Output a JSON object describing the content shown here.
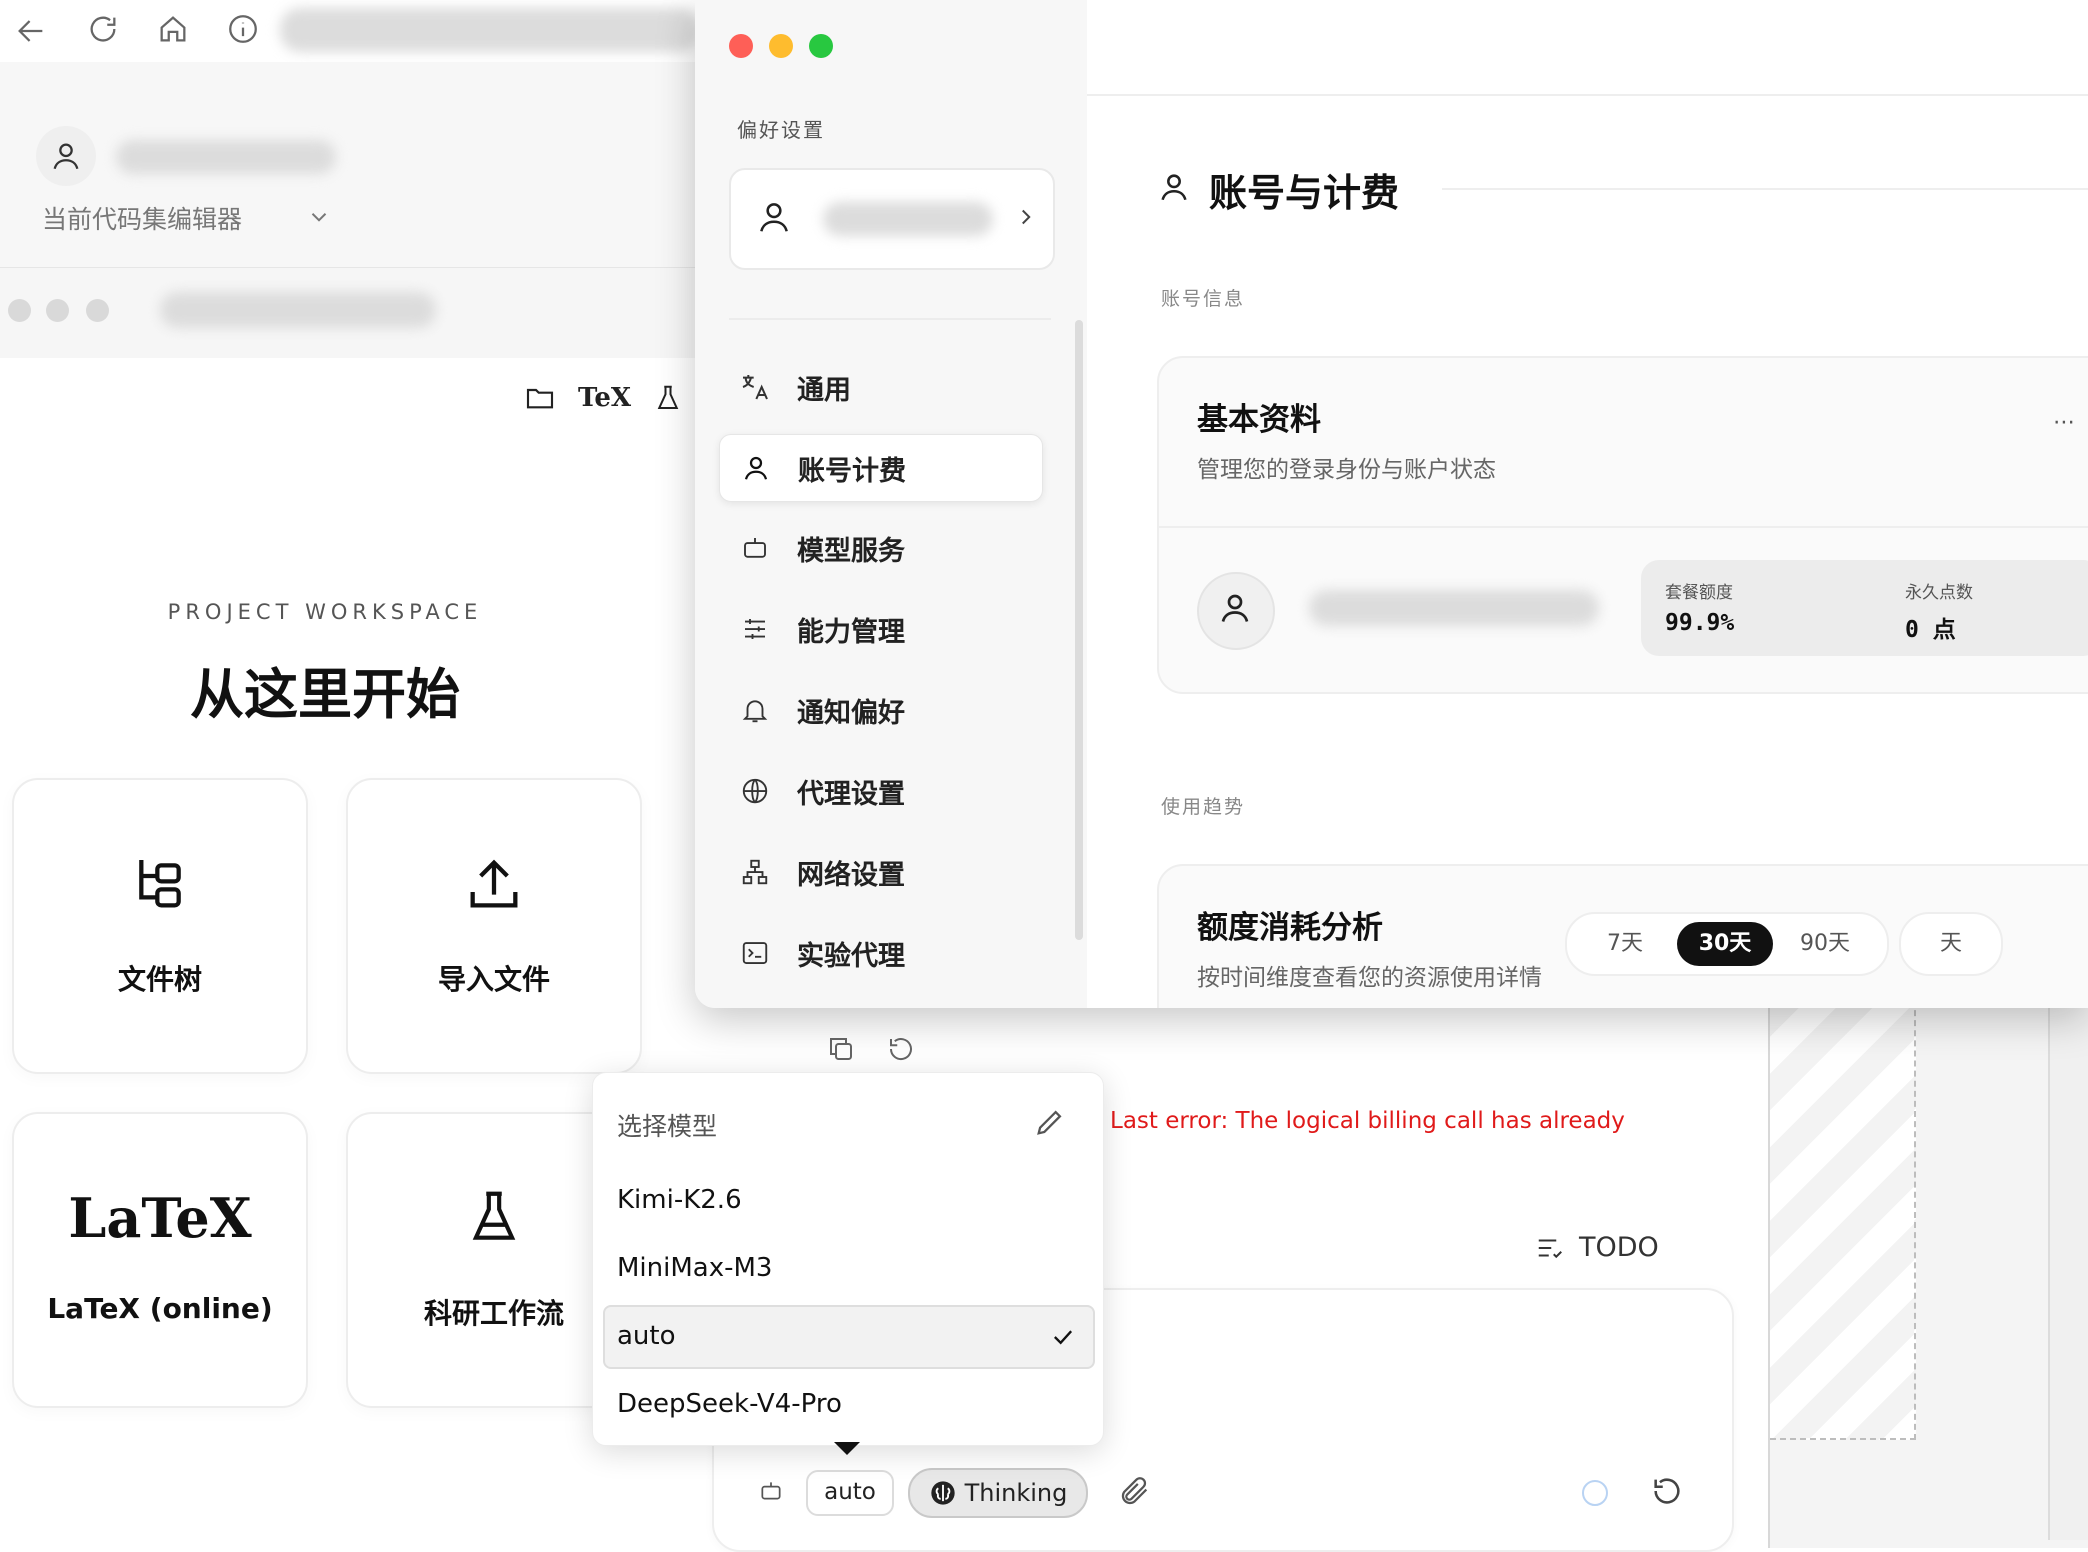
{
  "back_app": {
    "editor_label": "当前代码集编辑器",
    "tex_icon_label": "TeX",
    "workspace": {
      "eyebrow": "PROJECT WORKSPACE",
      "title": "从这里开始",
      "cards": [
        {
          "label": "文件树",
          "icon": "file-tree-icon"
        },
        {
          "label": "导入文件",
          "icon": "upload-icon"
        },
        {
          "label": "LaTeX (online)",
          "icon": "latex-logo-icon",
          "logo_text": "LaTeX"
        },
        {
          "label": "科研工作流",
          "icon": "flask-icon"
        }
      ]
    }
  },
  "chat": {
    "error": "Last error: The logical billing call has already",
    "todo_label": "TODO",
    "model_chip": "auto",
    "thinking_chip": "Thinking",
    "model_dropdown": {
      "title": "选择模型",
      "options": [
        "Kimi-K2.6",
        "MiniMax-M3",
        "auto",
        "DeepSeek-V4-Pro"
      ],
      "selected": "auto"
    }
  },
  "prefs": {
    "sidebar_label": "偏好设置",
    "nav": [
      {
        "label": "通用",
        "icon": "translate-icon"
      },
      {
        "label": "账号计费",
        "icon": "user-icon",
        "active": true
      },
      {
        "label": "模型服务",
        "icon": "robot-icon"
      },
      {
        "label": "能力管理",
        "icon": "sliders-icon"
      },
      {
        "label": "通知偏好",
        "icon": "bell-icon"
      },
      {
        "label": "代理设置",
        "icon": "globe-icon"
      },
      {
        "label": "网络设置",
        "icon": "network-icon"
      },
      {
        "label": "实验代理",
        "icon": "terminal-icon"
      }
    ],
    "main": {
      "title": "账号与计费",
      "section_account": "账号信息",
      "profile": {
        "title": "基本资料",
        "subtitle": "管理您的登录身份与账户状态",
        "quota_label": "套餐额度",
        "quota_value": "99.9%",
        "points_label": "永久点数",
        "points_value": "0 点"
      },
      "section_usage": "使用趋势",
      "usage": {
        "title": "额度消耗分析",
        "subtitle": "按时间维度查看您的资源使用详情",
        "ranges": [
          "7天",
          "30天",
          "90天"
        ],
        "active_range": "30天",
        "extra_range": "天"
      }
    }
  },
  "colors": {
    "traffic_red": "#fe5f57",
    "traffic_yellow": "#febc2e",
    "traffic_green": "#28c840",
    "error_red": "#e01a1a",
    "active_range_bg": "#111111"
  }
}
